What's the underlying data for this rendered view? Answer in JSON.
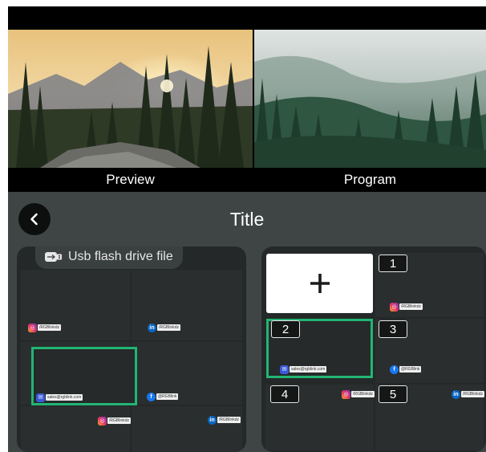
{
  "monitors": {
    "preview_label": "Preview",
    "program_label": "Program"
  },
  "header": {
    "title": "Title",
    "back_icon": "chevron-left-icon"
  },
  "source_panel": {
    "tab_label": "Usb flash drive file",
    "tab_icon": "usb-icon",
    "badges": [
      {
        "icon": "instagram-icon",
        "text": "/RGBlinkdz"
      },
      {
        "icon": "linkedin-icon",
        "text": "/RGBlinkdz"
      },
      {
        "icon": "mail-icon",
        "text": "sales@rgblink.com"
      },
      {
        "icon": "facebook-icon",
        "text": "@RGBlink"
      },
      {
        "icon": "instagram-icon",
        "text": "/RGBlinkdz"
      },
      {
        "icon": "linkedin-icon",
        "text": "/RGBlinkdz"
      }
    ]
  },
  "layout_panel": {
    "add_icon": "plus-icon",
    "slots": [
      "1",
      "2",
      "3",
      "4",
      "5"
    ],
    "badges": [
      {
        "icon": "instagram-icon",
        "text": "/RGBlinkdz"
      },
      {
        "icon": "mail-icon",
        "text": "sales@rgblink.com"
      },
      {
        "icon": "facebook-icon",
        "text": "@RGBlink"
      },
      {
        "icon": "instagram-icon",
        "text": "/RGBlinkdz"
      },
      {
        "icon": "linkedin-icon",
        "text": "/RGBlinkdz"
      }
    ]
  },
  "colors": {
    "accent_selection": "#22b573",
    "panel_bg": "#242828",
    "bar_bg": "#3f4545"
  }
}
